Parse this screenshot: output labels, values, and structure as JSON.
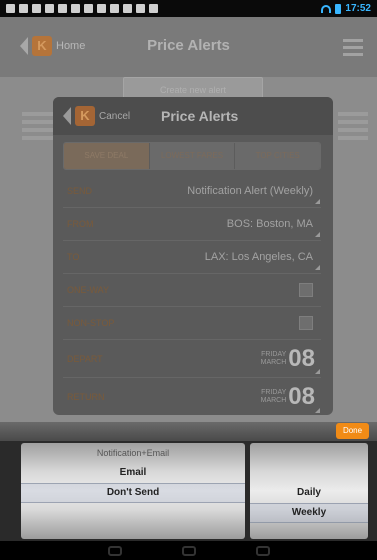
{
  "status_bar": {
    "time": "17:52"
  },
  "app": {
    "home_label": "Home",
    "title": "Price Alerts",
    "create_button": "Create new alert",
    "logo_letter": "K"
  },
  "dialog": {
    "cancel_label": "Cancel",
    "title": "Price Alerts",
    "tabs": [
      "SAVE DEAL",
      "LOWEST FARES",
      "TOP CITIES"
    ],
    "rows": {
      "send": {
        "label": "SEND",
        "value": "Notification Alert (Weekly)"
      },
      "from": {
        "label": "FROM",
        "value": "BOS: Boston, MA"
      },
      "to": {
        "label": "TO",
        "value": "LAX: Los Angeles, CA"
      },
      "one_way": {
        "label": "ONE-WAY"
      },
      "non_stop": {
        "label": "NON-STOP"
      },
      "depart": {
        "label": "DEPART",
        "weekday": "FRIDAY",
        "month": "MARCH",
        "day": "08"
      },
      "return": {
        "label": "RETURN",
        "weekday": "FRIDAY",
        "month": "MARCH",
        "day": "08"
      }
    }
  },
  "picker": {
    "done_label": "Done",
    "wheel1_options": [
      "Notification+Email",
      "Email",
      "Don't Send"
    ],
    "wheel2_options": [
      "Daily",
      "Weekly"
    ],
    "wheel1_selected": "Email",
    "wheel2_selected": "Weekly"
  },
  "colors": {
    "accent": "#f18b16",
    "status_blue": "#39b6ff"
  }
}
